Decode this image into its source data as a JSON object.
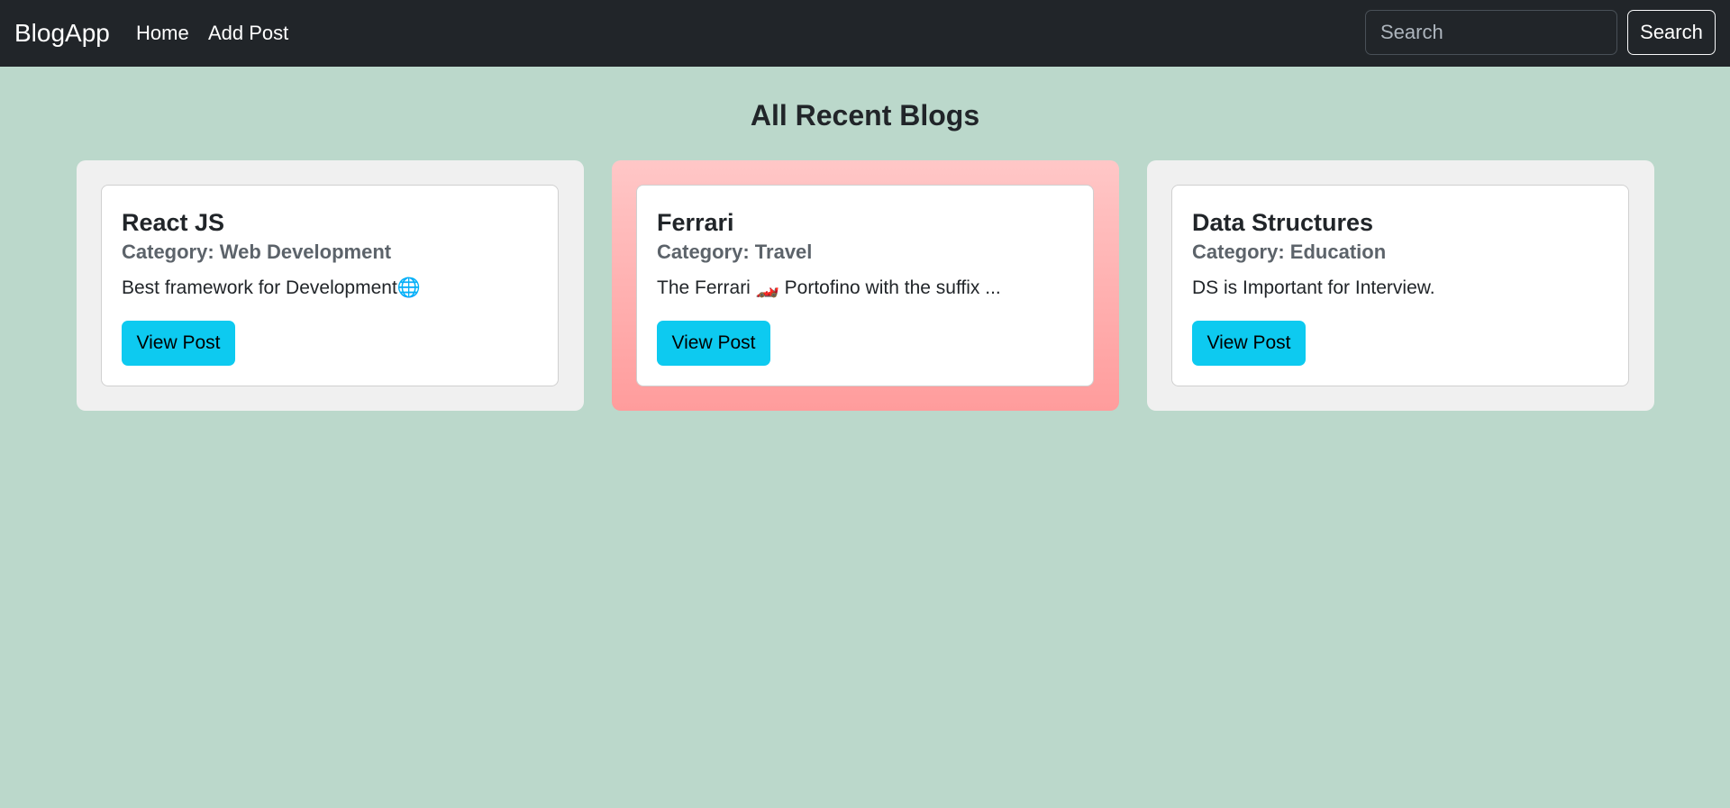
{
  "navbar": {
    "brand": "BlogApp",
    "links": [
      {
        "label": "Home"
      },
      {
        "label": "Add Post"
      }
    ],
    "search": {
      "placeholder": "Search",
      "value": "",
      "button_label": "Search"
    }
  },
  "main": {
    "title": "All Recent Blogs",
    "posts": [
      {
        "title": "React JS",
        "category": "Category: Web Development",
        "excerpt": "Best framework for Development🌐",
        "button_label": "View Post",
        "highlighted": false
      },
      {
        "title": "Ferrari",
        "category": "Category: Travel",
        "excerpt": "The Ferrari 🏎️ Portofino with the suffix ...",
        "button_label": "View Post",
        "highlighted": true
      },
      {
        "title": "Data Structures",
        "category": "Category: Education",
        "excerpt": "DS is Important for Interview.",
        "button_label": "View Post",
        "highlighted": false
      }
    ]
  },
  "colors": {
    "page_background": "#bbd8cb",
    "navbar_background": "#212529",
    "button_primary": "#0dcaf0",
    "highlight_gradient_top": "#ffc7c7",
    "highlight_gradient_bottom": "#ff9c9c",
    "card_frame": "#f0f0f0"
  }
}
